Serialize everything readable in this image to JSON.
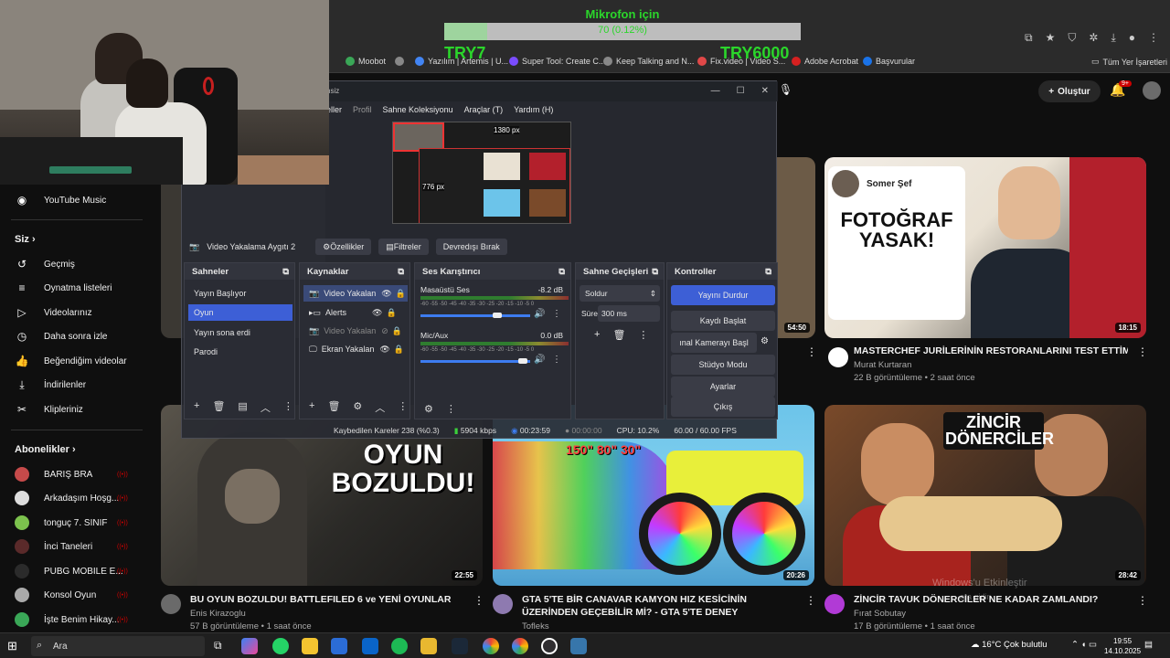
{
  "overlay": {
    "mic_title": "Mikrofon için",
    "mic_percent": "70 (0.12%)",
    "mic_level": 0.12,
    "try_left": "TRY7",
    "try_right": "TRY6000"
  },
  "bookmarks": [
    {
      "label": "Moobot",
      "color": "#3aa757"
    },
    {
      "label": "Yazılım | Artemis | U...",
      "color": "#4285f4"
    },
    {
      "label": "Super Tool: Create C...",
      "color": "#7a4cff"
    },
    {
      "label": "Keep Talking and N...",
      "color": "#888888"
    },
    {
      "label": "Fix.video | Video S...",
      "color": "#e04848"
    },
    {
      "label": "Adobe Acrobat",
      "color": "#d62020"
    },
    {
      "label": "Başvurular",
      "color": "#1a73e8"
    },
    {
      "label": "Tüm Yer İşaretleri",
      "color": "#cccccc"
    }
  ],
  "header": {
    "create_label": "Oluştur",
    "notif_badge": "9+"
  },
  "sidebar": {
    "music": "YouTube Music",
    "you_header": "Siz",
    "you_items": [
      "Geçmiş",
      "Oynatma listeleri",
      "Videolarınız",
      "Daha sonra izle",
      "Beğendiğim videolar",
      "İndirilenler",
      "Klipleriniz"
    ],
    "subs_header": "Abonelikler",
    "subs": [
      {
        "name": "BARIŞ BRA",
        "color": "#c64a4a"
      },
      {
        "name": "Arkadaşım Hoşg...",
        "color": "#dddddd"
      },
      {
        "name": "tonguç 7. SINIF",
        "color": "#7cc24d"
      },
      {
        "name": "İnci Taneleri",
        "color": "#5a2a2a"
      },
      {
        "name": "PUBG MOBILE E...",
        "color": "#2b2b2b"
      },
      {
        "name": "Konsol Oyun",
        "color": "#aaaaaa"
      },
      {
        "name": "İşte Benim Hikay...",
        "color": "#3aa757"
      }
    ]
  },
  "videos": [
    {
      "thumb_text": "FOTOĞRAF YASAK!",
      "badge_text": "Somer Şef",
      "duration": "18:15",
      "title": "MASTERCHEF JURİLERİNİN RESTORANLARINI TEST ETTİM!",
      "channel": "Murat Kurtaran",
      "meta": "22 B görüntüleme • 2 saat önce"
    },
    {
      "thumb_text": "OYUN BOZULDU!",
      "duration": "22:55",
      "title": "BU OYUN BOZULDU! BATTLEFILED 6 ve YENİ OYUNLAR",
      "channel": "Enis Kirazoglu",
      "meta": "57 B görüntüleme • 1 saat önce"
    },
    {
      "thumb_text": "150\" 80\" 30\"",
      "duration": "20:26",
      "title": "GTA 5'TE BİR CANAVAR KAMYON HIZ KESİCİNİN ÜZERİNDEN GEÇEBİLİR Mİ? - GTA 5'TE DENEY",
      "channel": "Tofleks",
      "meta": ""
    },
    {
      "thumb_text": "ZİNCİR DÖNERCİLER",
      "duration": "28:42",
      "title": "ZİNCİR TAVUK DÖNERCİLER NE KADAR ZAMLANDI?",
      "channel": "Fırat Sobutay",
      "meta": "17 B görüntüleme • 1 saat önce"
    },
    {
      "duration": "54:50"
    }
  ],
  "obs": {
    "title": "nsiz",
    "menu": [
      "eller",
      "Profil",
      "Sahne Koleksiyonu",
      "Araçlar (T)",
      "Yardım (H)"
    ],
    "preview_label_w": "1380 px",
    "preview_label_h": "776 px",
    "source_name": "Video Yakalama Aygıtı 2",
    "btn_props": "Özellikler",
    "btn_filters": "Filtreler",
    "btn_deactivate": "Devredışı Bırak",
    "scenes_header": "Sahneler",
    "scenes": [
      "Yayın Başlıyor",
      "Oyun",
      "Yayın sona erdi",
      "Parodi"
    ],
    "sources_header": "Kaynaklar",
    "sources": [
      "Video Yakalan",
      "Alerts",
      "Video Yakalan",
      "Ekran Yakalan"
    ],
    "mixer_header": "Ses Karıştırıcı",
    "mixer": [
      {
        "name": "Masaüstü Ses",
        "db": "-8.2 dB",
        "level": 0.7
      },
      {
        "name": "Mic/Aux",
        "db": "0.0 dB",
        "level": 0.93
      }
    ],
    "mixer_scale": "-60 -55 -50 -45 -40 -35 -30 -25 -20 -15 -10 -5 0",
    "trans_header": "Sahne Geçişleri",
    "trans_type": "Soldur",
    "trans_duration_label": "Süre",
    "trans_duration": "300 ms",
    "controls_header": "Kontroller",
    "controls": [
      "Yayını Durdur",
      "Kaydı Başlat",
      "ınal Kamerayı Başl",
      "Stüdyo Modu",
      "Ayarlar",
      "Çıkış"
    ],
    "status": {
      "dropped": "Kaybedilen Kareler 238 (%0.3)",
      "bitrate": "5904 kbps",
      "live_time": "00:23:59",
      "rec_time": "00:00:00",
      "cpu": "CPU: 10.2%",
      "fps": "60.00 / 60.00 FPS"
    }
  },
  "watermark": {
    "line1": "Windows'u Etkinleştir",
    "line2": "ara gidin."
  },
  "taskbar": {
    "search": "Ara",
    "weather": "16°C  Çok bulutlu",
    "time": "19:55",
    "date": "14.10.2025"
  }
}
